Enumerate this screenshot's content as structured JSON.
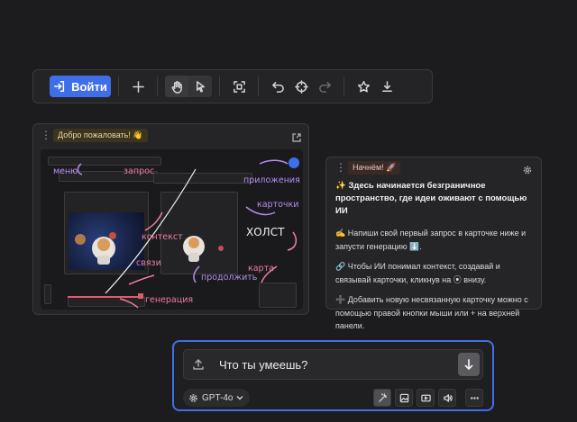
{
  "toolbar": {
    "login_label": "Войти",
    "icons": [
      "login-icon",
      "plus-icon",
      "hand-icon",
      "cursor-icon",
      "frame-icon",
      "undo-icon",
      "target-icon",
      "redo-icon",
      "star-icon",
      "download-icon"
    ]
  },
  "welcome_card": {
    "title": "Добро пожаловать! 👋",
    "annotations": {
      "menu": "меню",
      "request": "запрос",
      "apps": "приложения",
      "cards": "карточки",
      "context": "контекст",
      "canvas": "ХОЛСТ",
      "links": "связи",
      "map": "карта",
      "continue": "продолжить",
      "generation": "генерация"
    }
  },
  "info_card": {
    "title": "Начнём! 🚀",
    "headline": "✨ Здесь начинается безграничное пространство, где идеи оживают с помощью ИИ",
    "paragraphs": [
      "✍️ Напиши свой первый запрос в карточке ниже и запусти генерацию ⬇️.",
      "🔗 Чтобы ИИ понимал контекст, создавай и связывай карточки, кликнув на ⦿ внизу.",
      "➕ Добавить новую несвязанную карточку можно с помощью правой кнопки мыши или + на верхней панели."
    ]
  },
  "prompt": {
    "text": "Что ты умеешь?",
    "model": "GPT-4o",
    "tools": [
      "magic-wand-icon",
      "image-icon",
      "video-icon",
      "audio-icon",
      "more-icon"
    ]
  },
  "colors": {
    "accent": "#3f6fe8",
    "annotation_pink": "#f07aa9",
    "annotation_purple": "#b58cf0"
  }
}
